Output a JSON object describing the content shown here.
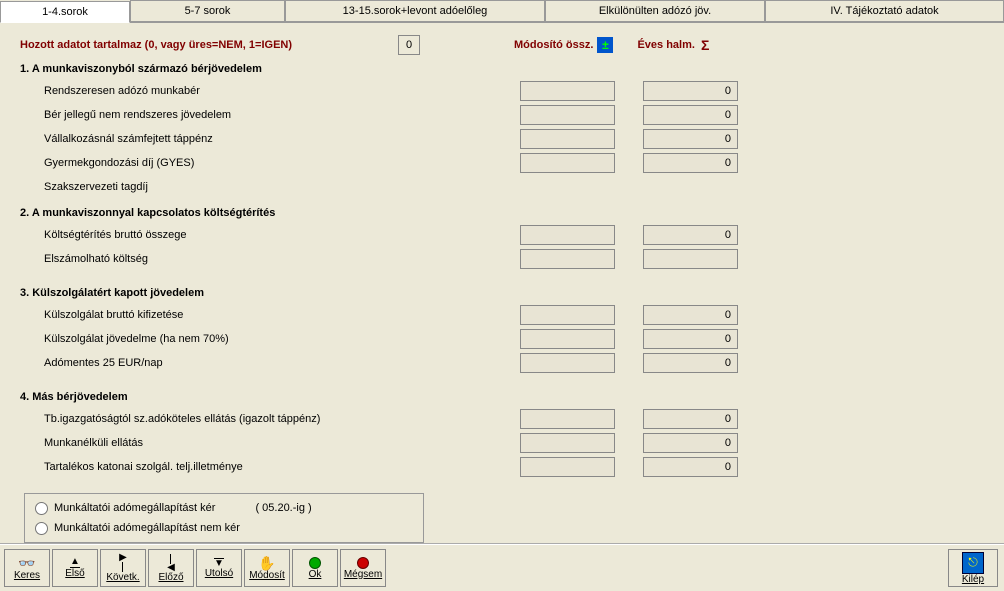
{
  "tabs": {
    "t1": "1-4.sorok",
    "t2": "5-7 sorok",
    "t3": "13-15.sorok+levont adóelőleg",
    "t4": "Elkülönülten adózó jöv.",
    "t5": "IV. Tájékoztató adatok"
  },
  "header": {
    "hozott": "Hozott adatot  tartalmaz (0, vagy üres=NEM, 1=IGEN)",
    "hozott_val": "0",
    "mod": "Módosító össz.",
    "yr": "Éves halm."
  },
  "s1": {
    "head": "1. A munkaviszonyból származó bérjövedelem",
    "r1": "Rendszeresen adózó munkabér",
    "r2": "Bér jellegű nem rendszeres jövedelem",
    "r3": "Vállalkozásnál számfejtett táppénz",
    "r4": "Gyermekgondozási díj (GYES)",
    "r5": "Szakszervezeti tagdíj",
    "v1": "0",
    "v2": "0",
    "v3": "0",
    "v4": "0"
  },
  "s2": {
    "head": "2. A munkaviszonnyal kapcsolatos költségtérítés",
    "r1": "Költségtérítés bruttó összege",
    "r2": "Elszámolható költség",
    "v1": "0"
  },
  "s3": {
    "head": "3. Külszolgálatért kapott jövedelem",
    "r1": "Külszolgálat bruttó kifizetése",
    "r2": "Külszolgálat jövedelme (ha nem 70%)",
    "r3": "Adómentes 25 EUR/nap",
    "v1": "0",
    "v2": "0",
    "v3": "0"
  },
  "s4": {
    "head": "4. Más bérjövedelem",
    "r1": "Tb.igazgatóságtól sz.adóköteles ellátás (igazolt táppénz)",
    "r2": "Munkanélküli ellátás",
    "r3": "Tartalékos katonai szolgál. telj.illetménye",
    "v1": "0",
    "v2": "0",
    "v3": "0"
  },
  "options": {
    "o1": "Munkáltatói adómegállapítást kér",
    "o1_note": "( 05.20.-ig )",
    "o2": "Munkáltatói  adómegállapítást nem kér"
  },
  "toolbar": {
    "keres": "Keres",
    "elso": "Első",
    "kovet": "Követk.",
    "elozo": "Előző",
    "utolso": "Utolsó",
    "modosit": "Módosít",
    "ok": "Ok",
    "megsem": "Mégsem",
    "kilep": "Kilép"
  }
}
